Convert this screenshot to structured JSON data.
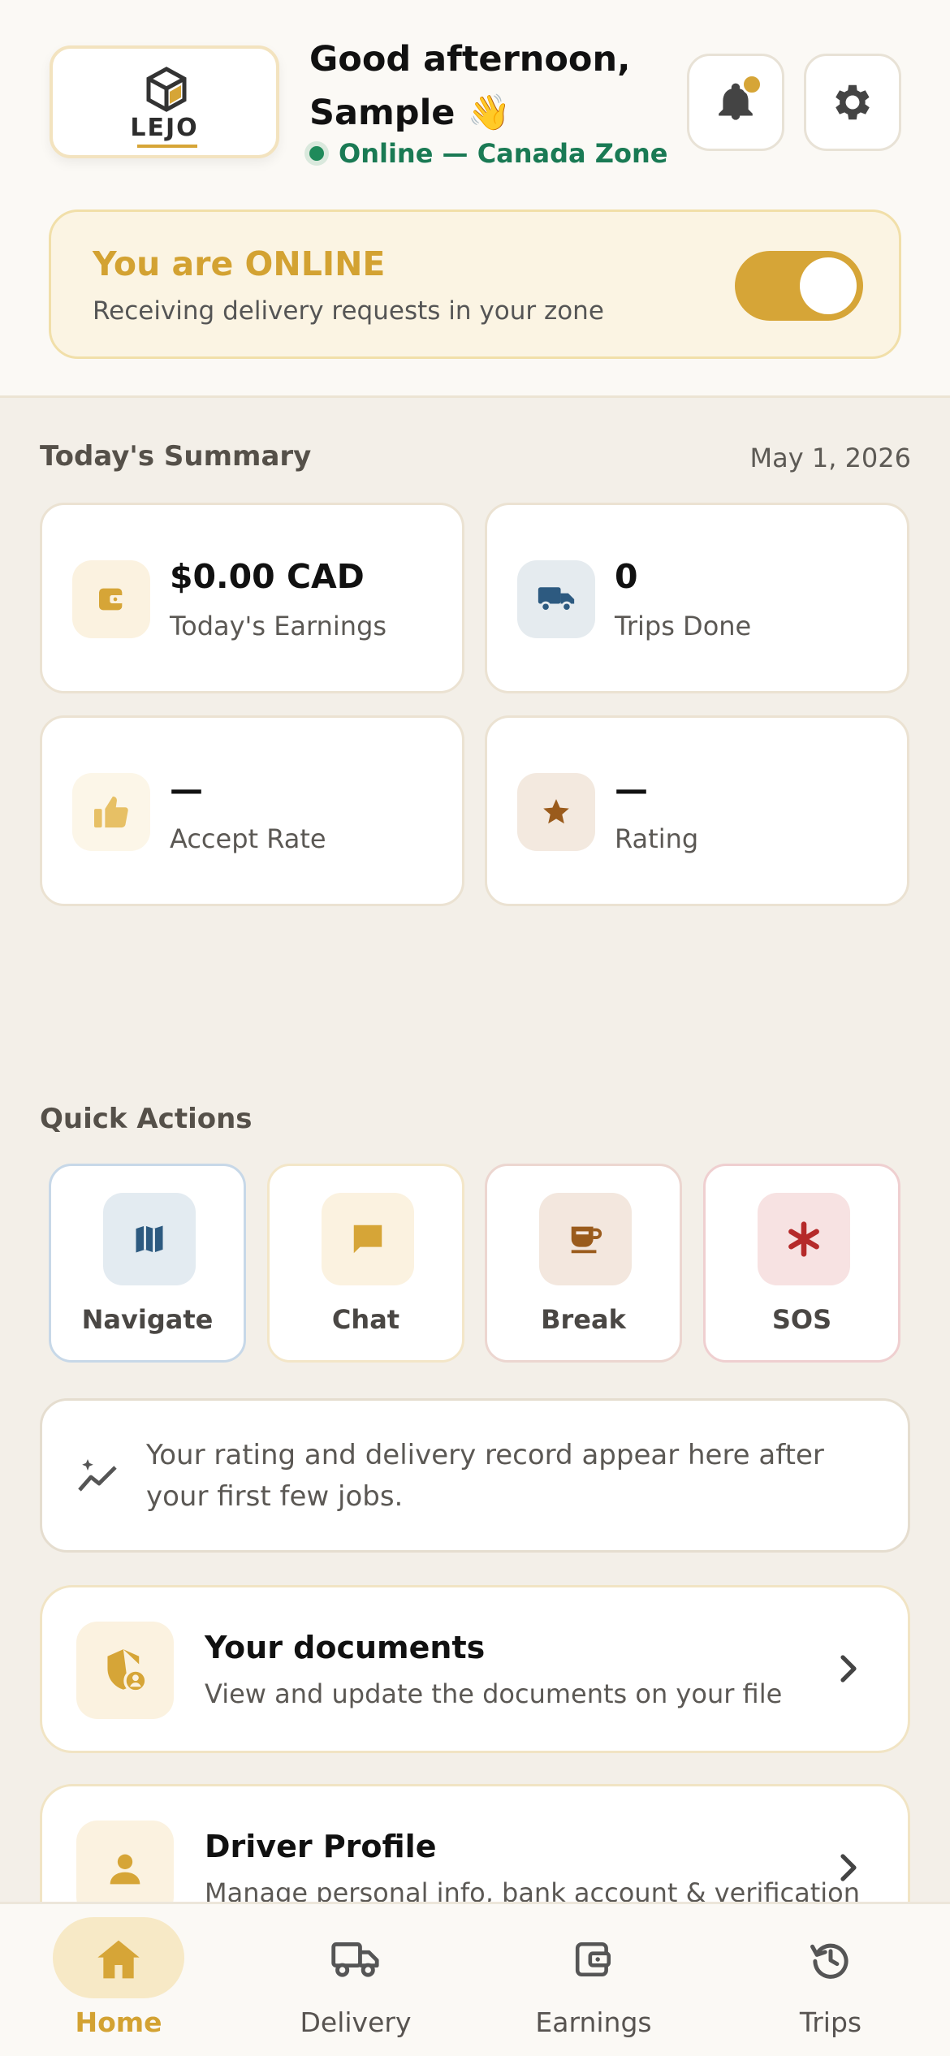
{
  "header": {
    "logo_text": "LEJO",
    "greeting_line1": "Good afternoon,",
    "greeting_line2": "Sample 👋",
    "status_text": "Online — Canada Zone",
    "notification_icon": "bell-icon",
    "settings_icon": "gear-icon"
  },
  "online_card": {
    "title": "You are ONLINE",
    "subtitle": "Receiving delivery requests in your zone",
    "toggle_on": true
  },
  "summary": {
    "title": "Today's Summary",
    "date": "May 1, 2026",
    "stats": [
      {
        "value": "$0.00 CAD",
        "label": "Today's Earnings",
        "icon": "wallet-icon"
      },
      {
        "value": "0",
        "label": "Trips Done",
        "icon": "truck-icon"
      },
      {
        "value": "—",
        "label": "Accept Rate",
        "icon": "thumbs-up-icon"
      },
      {
        "value": "—",
        "label": "Rating",
        "icon": "star-icon"
      }
    ]
  },
  "quick_actions": {
    "title": "Quick Actions",
    "items": [
      {
        "label": "Navigate",
        "icon": "map-icon"
      },
      {
        "label": "Chat",
        "icon": "chat-icon"
      },
      {
        "label": "Break",
        "icon": "coffee-icon"
      },
      {
        "label": "SOS",
        "icon": "asterisk-icon"
      }
    ]
  },
  "info_banner": {
    "text": "Your rating and delivery record appear here after your first few jobs."
  },
  "documents": {
    "title": "Your documents",
    "subtitle": "View and update the documents on your file"
  },
  "profile": {
    "title": "Driver Profile",
    "subtitle": "Manage personal info, bank account & verification"
  },
  "bottom_nav": {
    "items": [
      {
        "label": "Home",
        "icon": "home-icon",
        "active": true
      },
      {
        "label": "Delivery",
        "icon": "truck-icon",
        "active": false
      },
      {
        "label": "Earnings",
        "icon": "wallet-icon",
        "active": false
      },
      {
        "label": "Trips",
        "icon": "history-icon",
        "active": false
      }
    ]
  },
  "colors": {
    "accent": "#d6a537",
    "online_green": "#1a7a54",
    "background": "#f3efe8"
  }
}
